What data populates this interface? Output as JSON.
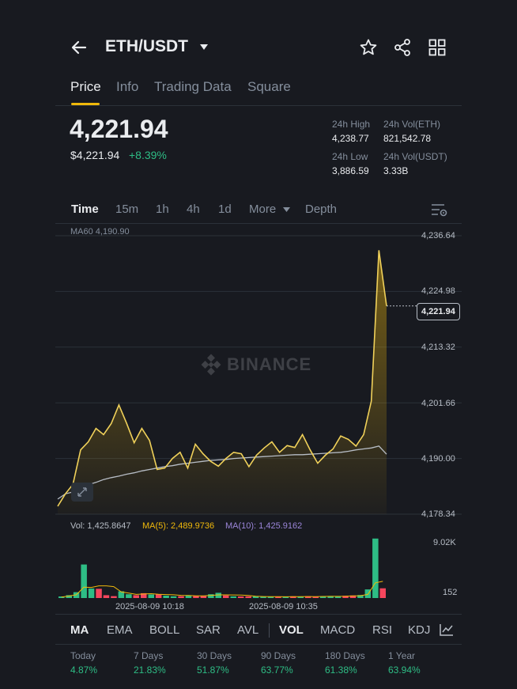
{
  "header": {
    "pair": "ETH/USDT"
  },
  "tabs": [
    {
      "label": "Price",
      "active": true
    },
    {
      "label": "Info",
      "active": false
    },
    {
      "label": "Trading Data",
      "active": false
    },
    {
      "label": "Square",
      "active": false
    }
  ],
  "price": {
    "last": "4,221.94",
    "usd": "$4,221.94",
    "change": "+8.39%"
  },
  "stats": {
    "high_label": "24h High",
    "high_value": "4,238.77",
    "vol_eth_label": "24h Vol(ETH)",
    "vol_eth_value": "821,542.78",
    "low_label": "24h Low",
    "low_value": "3,886.59",
    "vol_usdt_label": "24h Vol(USDT)",
    "vol_usdt_value": "3.33B"
  },
  "time_tabs": [
    {
      "label": "Time",
      "active": true
    },
    {
      "label": "15m",
      "active": false
    },
    {
      "label": "1h",
      "active": false
    },
    {
      "label": "4h",
      "active": false
    },
    {
      "label": "1d",
      "active": false
    },
    {
      "label": "More",
      "active": false
    },
    {
      "label": "Depth",
      "active": false
    }
  ],
  "chart_legend": {
    "ma60": "MA60 4,190.90",
    "vol": "Vol: 1,425.8647",
    "ma5": "MA(5): 2,489.9736",
    "ma10": "MA(10): 1,425.9162"
  },
  "watermark": "BINANCE",
  "time_labels": [
    "2025-08-09 10:18",
    "2025-08-09 10:35"
  ],
  "indicator_tabs": [
    {
      "label": "MA",
      "active": true
    },
    {
      "label": "EMA",
      "active": false
    },
    {
      "label": "BOLL",
      "active": false
    },
    {
      "label": "SAR",
      "active": false
    },
    {
      "label": "AVL",
      "active": false
    },
    {
      "label": "VOL",
      "active": true
    },
    {
      "label": "MACD",
      "active": false
    },
    {
      "label": "RSI",
      "active": false
    },
    {
      "label": "KDJ",
      "active": false
    }
  ],
  "performance": [
    {
      "label": "Today",
      "value": "4.87%"
    },
    {
      "label": "7 Days",
      "value": "21.83%"
    },
    {
      "label": "30 Days",
      "value": "51.87%"
    },
    {
      "label": "90 Days",
      "value": "63.77%"
    },
    {
      "label": "180 Days",
      "value": "61.38%"
    },
    {
      "label": "1 Year",
      "value": "63.94%"
    }
  ],
  "colors": {
    "accent": "#f0b90b",
    "up": "#2ebd85",
    "down": "#f6465d",
    "ma_line": "#b7bdc6",
    "ma10": "#9b86d9"
  },
  "chart_data": [
    {
      "type": "area",
      "y_ticks": [
        "4,236.64",
        "4,224.98",
        "4,213.32",
        "4,201.66",
        "4,190.00",
        "4,178.34"
      ],
      "ylim": [
        4178.34,
        4236.64
      ],
      "current_price_label": "4,221.94",
      "price": [
        4180.0,
        4182.6,
        4184.6,
        4191.8,
        4193.5,
        4196.3,
        4195.0,
        4197.3,
        4201.2,
        4197.4,
        4193.3,
        4196.3,
        4193.8,
        4187.7,
        4188.0,
        4190.0,
        4191.3,
        4188.0,
        4193.0,
        4191.0,
        4189.4,
        4188.4,
        4190.0,
        4191.3,
        4191.0,
        4188.3,
        4190.7,
        4192.2,
        4193.5,
        4191.3,
        4192.7,
        4192.3,
        4195.0,
        4191.8,
        4189.0,
        4190.7,
        4192.0,
        4194.7,
        4194.0,
        4192.6,
        4195.0,
        4202.0,
        4233.6,
        4221.94
      ],
      "ma60": [
        4181.5,
        4182.6,
        4183.0,
        4183.8,
        4184.5,
        4185.0,
        4185.6,
        4186.0,
        4186.3,
        4186.7,
        4187.0,
        4187.4,
        4187.7,
        4188.0,
        4188.3,
        4188.5,
        4188.8,
        4189.0,
        4189.2,
        4189.4,
        4189.6,
        4189.7,
        4189.8,
        4190.0,
        4190.1,
        4190.2,
        4190.3,
        4190.4,
        4190.5,
        4190.6,
        4190.7,
        4190.8,
        4190.8,
        4190.9,
        4191.0,
        4191.1,
        4191.2,
        4191.3,
        4191.5,
        4191.8,
        4192.0,
        4192.2,
        4192.6,
        4190.9
      ]
    },
    {
      "type": "bar",
      "y_ticks": [
        "9.02K",
        "152"
      ],
      "volume": [
        150,
        420,
        860,
        4900,
        1400,
        1350,
        420,
        280,
        980,
        560,
        420,
        700,
        520,
        560,
        350,
        260,
        280,
        400,
        300,
        320,
        560,
        760,
        380,
        240,
        200,
        260,
        190,
        210,
        180,
        220,
        150,
        260,
        210,
        270,
        160,
        250,
        300,
        220,
        340,
        380,
        440,
        1260,
        8700,
        1425.86
      ],
      "up": [
        true,
        true,
        true,
        true,
        true,
        false,
        false,
        false,
        true,
        true,
        false,
        false,
        true,
        false,
        true,
        true,
        false,
        true,
        false,
        false,
        true,
        true,
        false,
        true,
        false,
        false,
        true,
        true,
        true,
        false,
        true,
        false,
        true,
        false,
        false,
        true,
        true,
        true,
        false,
        false,
        true,
        true,
        true,
        false
      ]
    }
  ]
}
